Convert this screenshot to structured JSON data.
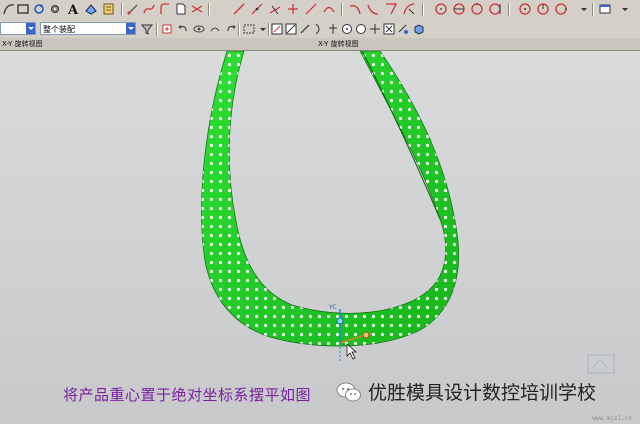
{
  "toolbar": {
    "selection_filter_value": "",
    "selection_scope_value": "整个装配"
  },
  "views": {
    "left_title": "X-Y 旋转视图",
    "right_title": "X-Y 旋转视图"
  },
  "viewport": {
    "triad_label": "YC"
  },
  "caption": "将产品重心置于绝对坐标系摆平如图",
  "watermark": {
    "brand": "优胜模具设计数控培训学校",
    "url": "www.mjzl.cn"
  },
  "colors": {
    "part_green": "#25d42a",
    "caption_purple": "#7a1fa0",
    "toolbar_bg": "#d4d0c8"
  }
}
